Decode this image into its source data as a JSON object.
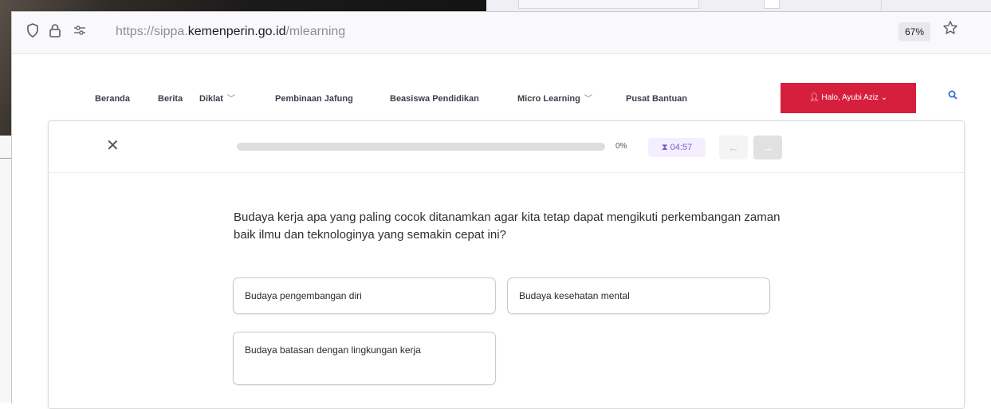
{
  "browser": {
    "url_prefix": "https://sippa.",
    "url_host": "kemenperin.go.id",
    "url_path": "/mlearning",
    "zoom": "67%"
  },
  "nav": {
    "items": [
      "Beranda",
      "Berita",
      "Diklat",
      "Pembinaan Jafung",
      "Beasiswa Pendidikan",
      "Micro Learning",
      "Pusat Bantuan"
    ],
    "user_label": "Halo, Ayubi Aziz",
    "accent_color": "#d61f3c"
  },
  "quiz": {
    "progress_fraction": 0,
    "progress_text": "0%",
    "timer": "04:57",
    "question": "Budaya kerja apa yang paling cocok ditanamkan agar kita tetap dapat mengikuti perkembangan zaman baik ilmu dan teknologinya yang semakin cepat ini?",
    "options": [
      "Budaya pengembangan diri",
      "Budaya kesehatan mental",
      "Budaya batasan dengan lingkungan kerja"
    ]
  },
  "icons": {
    "shield": "shield-icon",
    "lock": "lock-icon",
    "permissions": "permissions-icon",
    "star": "bookmark-star-icon",
    "close": "close-icon",
    "timer": "timer-icon",
    "prev": "arrow-left-icon",
    "next": "arrow-right-icon",
    "user": "user-icon",
    "search": "search-icon"
  }
}
